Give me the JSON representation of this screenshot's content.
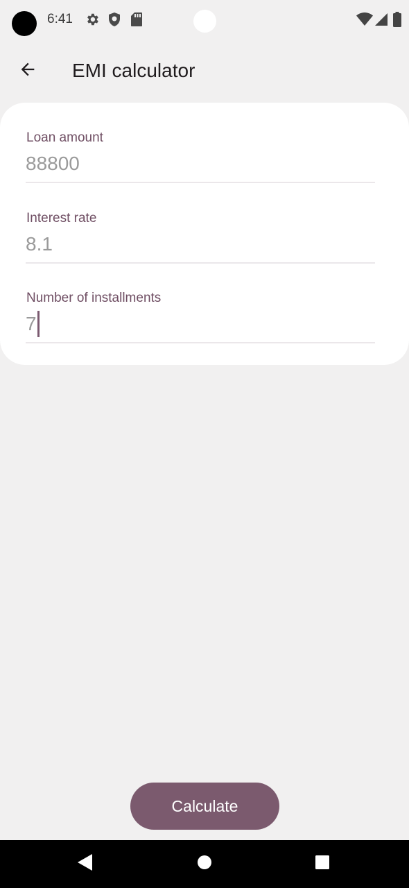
{
  "status_bar": {
    "time": "6:41",
    "icons": [
      "gear-icon",
      "shield-icon",
      "sd-card-icon",
      "wifi-icon",
      "signal-icon",
      "battery-icon"
    ]
  },
  "app_bar": {
    "title": "EMI calculator",
    "back_icon": "arrow-back-icon"
  },
  "form": {
    "loan_amount": {
      "label": "Loan amount",
      "value": "88800"
    },
    "interest_rate": {
      "label": "Interest rate",
      "value": "8.1"
    },
    "installments": {
      "label": "Number of installments",
      "value": "7"
    }
  },
  "actions": {
    "calculate_label": "Calculate"
  },
  "nav_bar": {
    "buttons": [
      "back-triangle-icon",
      "home-circle-icon",
      "recents-square-icon"
    ]
  },
  "colors": {
    "accent": "#7b5a6e",
    "label": "#6f4e63",
    "background": "#f1f0f0",
    "card": "#ffffff"
  }
}
